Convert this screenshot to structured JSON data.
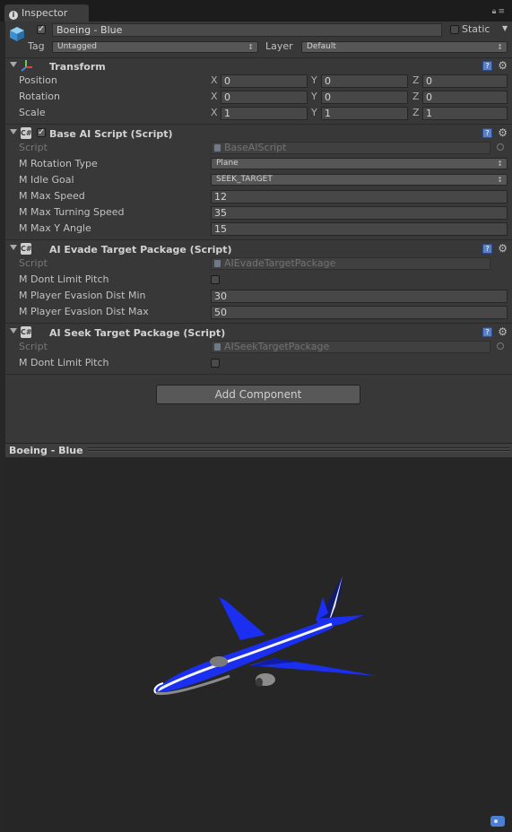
{
  "tab": {
    "title": "Inspector"
  },
  "gameobject": {
    "active": true,
    "name": "Boeing - Blue",
    "static_label": "Static",
    "tag_label": "Tag",
    "tag_value": "Untagged",
    "layer_label": "Layer",
    "layer_value": "Default"
  },
  "transform": {
    "title": "Transform",
    "position": {
      "label": "Position",
      "x": "0",
      "y": "0",
      "z": "0"
    },
    "rotation": {
      "label": "Rotation",
      "x": "0",
      "y": "0",
      "z": "0"
    },
    "scale": {
      "label": "Scale",
      "x": "1",
      "y": "1",
      "z": "1"
    },
    "axis": {
      "x": "X",
      "y": "Y",
      "z": "Z"
    }
  },
  "base_ai": {
    "title": "Base AI Script (Script)",
    "enabled": true,
    "script_label": "Script",
    "script_value": "BaseAIScript",
    "rotation_type_label": "M Rotation Type",
    "rotation_type_value": "Plane",
    "idle_goal_label": "M Idle Goal",
    "idle_goal_value": "SEEK_TARGET",
    "max_speed_label": "M Max Speed",
    "max_speed_value": "12",
    "max_turning_label": "M Max Turning Speed",
    "max_turning_value": "35",
    "max_y_angle_label": "M Max Y Angle",
    "max_y_angle_value": "15"
  },
  "evade": {
    "title": "AI Evade Target Package (Script)",
    "script_label": "Script",
    "script_value": "AIEvadeTargetPackage",
    "dont_limit_label": "M Dont Limit Pitch",
    "dont_limit_checked": false,
    "dist_min_label": "M Player Evasion Dist Min",
    "dist_min_value": "30",
    "dist_max_label": "M Player Evasion Dist Max",
    "dist_max_value": "50"
  },
  "seek": {
    "title": "AI Seek Target Package (Script)",
    "script_label": "Script",
    "script_value": "AISeekTargetPackage",
    "dont_limit_label": "M Dont Limit Pitch",
    "dont_limit_checked": false
  },
  "add_component_label": "Add Component",
  "preview": {
    "title": "Boeing - Blue"
  },
  "icons": [
    "info-icon",
    "lock-icon",
    "menu-icon",
    "cube-icon",
    "transform-icon",
    "script-icon",
    "help-icon",
    "gear-icon",
    "target-icon",
    "tag-icon"
  ],
  "colors": {
    "plane_blue": "#1a2ff0",
    "panel": "#383838",
    "preview_bg": "#262626"
  }
}
